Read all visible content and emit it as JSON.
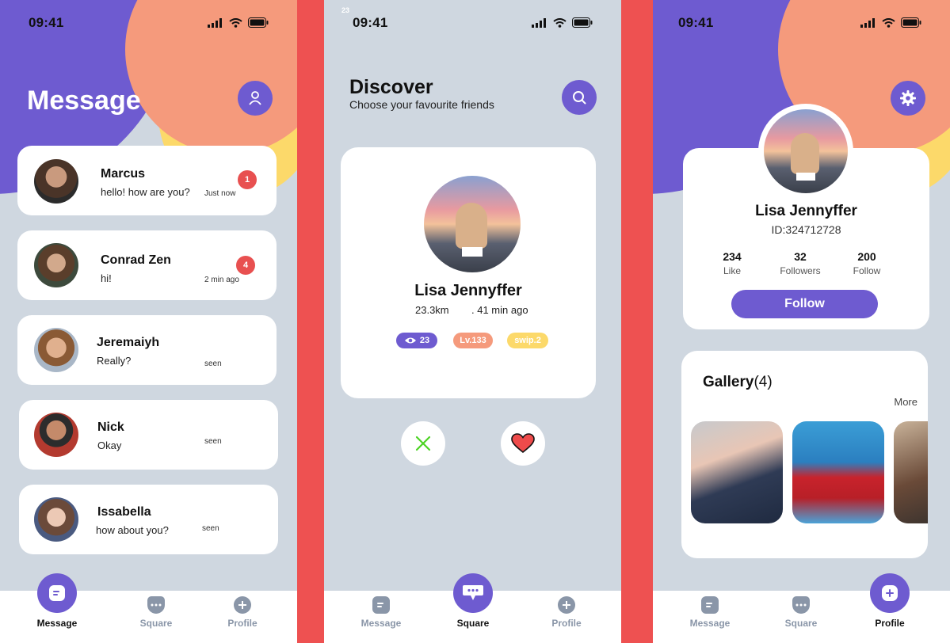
{
  "status": {
    "time": "09:41"
  },
  "message_screen": {
    "title": "Message",
    "conversations": [
      {
        "name": "Marcus",
        "text": "hello! how are you?",
        "time": "Just now",
        "unread": "1"
      },
      {
        "name": "Conrad Zen",
        "text": "hi!",
        "time": "2 min ago",
        "unread": "4"
      },
      {
        "name": "Jeremaiyh",
        "text": "Really?",
        "time": "seen",
        "unread": ""
      },
      {
        "name": "Nick",
        "text": "Okay",
        "time": "seen",
        "unread": ""
      },
      {
        "name": "Issabella",
        "text": "how about you?",
        "time": "seen",
        "unread": ""
      }
    ]
  },
  "discover_screen": {
    "corner_tag": "23",
    "title": "Discover",
    "subtitle": "Choose your favourite friends",
    "profile": {
      "name": "Lisa Jennyffer",
      "distance": "23.3km",
      "last_seen": ". 41 min ago",
      "views": "23",
      "level": "Lv.133",
      "swipes": "swip.2"
    }
  },
  "profile_screen": {
    "name": "Lisa Jennyffer",
    "id": "ID:324712728",
    "stats": [
      {
        "value": "234",
        "label": "Like"
      },
      {
        "value": "32",
        "label": "Followers"
      },
      {
        "value": "200",
        "label": "Follow"
      }
    ],
    "follow_label": "Follow",
    "gallery_label": "Gallery",
    "gallery_count": "(4)",
    "more_label": "More"
  },
  "nav": {
    "message": "Message",
    "square": "Square",
    "profile": "Profile"
  },
  "colors": {
    "purple": "#6e5bd0",
    "salmon": "#f59a7c",
    "yellow": "#fcd96a",
    "red": "#ee5151",
    "bg": "#cfd7e0"
  }
}
